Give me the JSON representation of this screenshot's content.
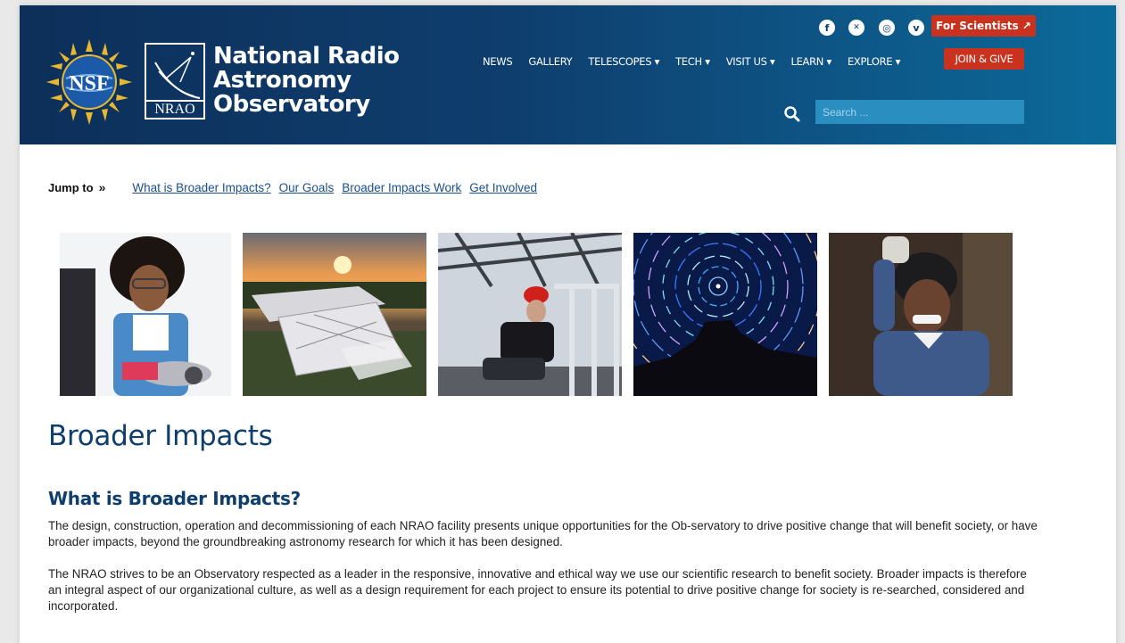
{
  "header": {
    "org_name_lines": [
      "National Radio",
      "Astronomy",
      "Observatory"
    ],
    "nrao_mark": "NRAO",
    "nsf_mark": "NSF",
    "social_icons": [
      {
        "name": "facebook-icon",
        "glyph": "f"
      },
      {
        "name": "x-icon",
        "glyph": "✕"
      },
      {
        "name": "instagram-icon",
        "glyph": "◎"
      },
      {
        "name": "vimeo-icon",
        "glyph": "v"
      }
    ],
    "for_scientists_label": "For Scientists ↗",
    "nav": [
      "NEWS",
      "GALLERY",
      "TELESCOPES ▾",
      "TECH ▾",
      "VISIT US ▾",
      "LEARN ▾",
      "EXPLORE ▾"
    ],
    "join_label": "JOIN & GIVE",
    "search_placeholder": "Search ..."
  },
  "jump": {
    "label": "Jump to",
    "arrows": "»",
    "links": [
      "What is Broader Impacts?",
      "Our Goals",
      "Broader Impacts Work",
      "Get Involved"
    ]
  },
  "photos": [
    {
      "name": "photo-girl-robotics"
    },
    {
      "name": "photo-telescope-sunset"
    },
    {
      "name": "photo-engineer-hardhat"
    },
    {
      "name": "photo-star-trails"
    },
    {
      "name": "photo-welder"
    }
  ],
  "main": {
    "title": "Broader Impacts",
    "section_title": "What is Broader Impacts?",
    "paragraphs": [
      "The design, construction, operation and decommissioning of each NRAO facility presents unique opportunities for the Ob-servatory to drive positive change that will benefit society, or have broader impacts, beyond the groundbreaking astronomy research for which it has been designed.",
      "The NRAO strives to be an Observatory respected as a leader in the responsive, innovative and ethical way we use our scientific research to benefit society. Broader impacts is therefore an integral aspect of our organizational culture, as well as a design requirement for each project to ensure its potential to drive positive change for society is re-searched, considered and incorporated."
    ]
  },
  "colors": {
    "brand_navy": "#0e3e6e",
    "accent_red": "#c8321e",
    "search_blue": "#2a8fc0",
    "link_blue": "#1a4f8c"
  }
}
